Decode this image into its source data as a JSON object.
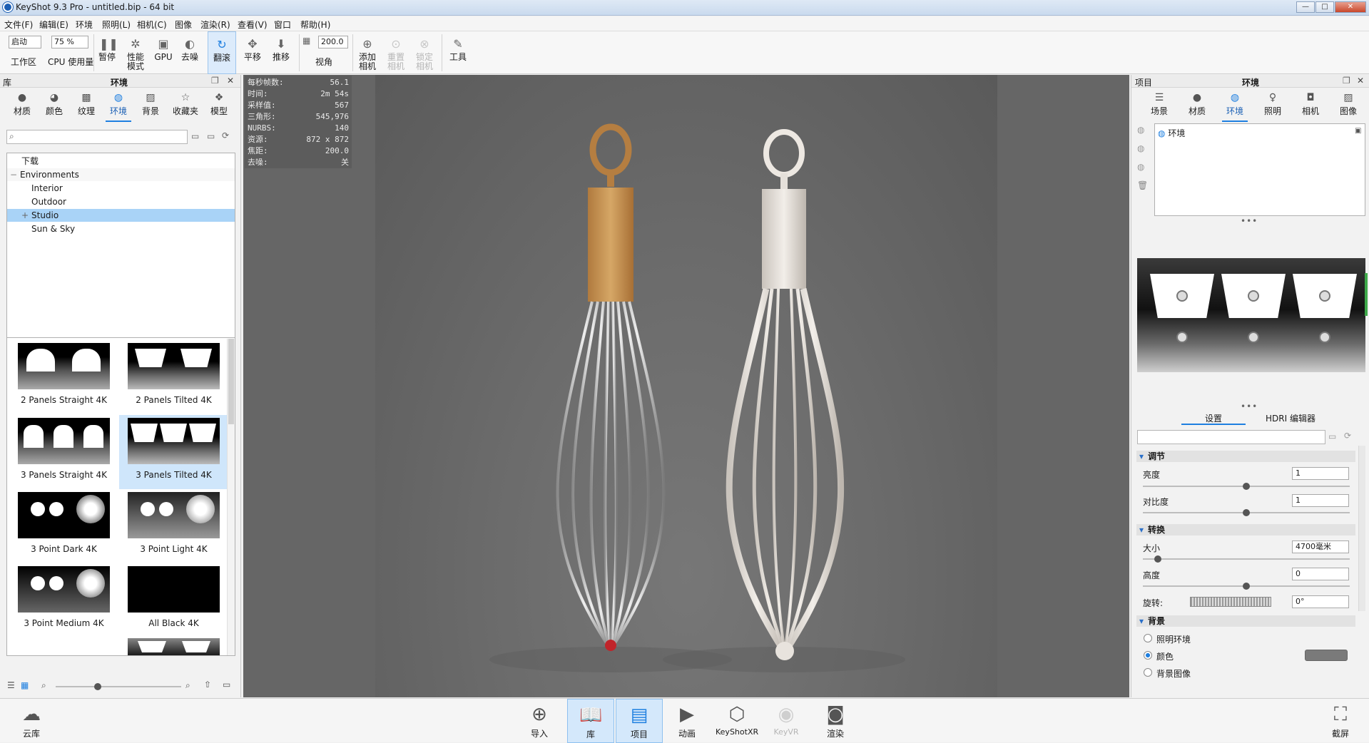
{
  "window": {
    "title": "KeyShot 9.3 Pro  - untitled.bip  - 64 bit",
    "min": "—",
    "max": "□",
    "close": "✕"
  },
  "menu": [
    "文件(F)",
    "编辑(E)",
    "环境",
    "照明(L)",
    "相机(C)",
    "图像",
    "渲染(R)",
    "查看(V)",
    "窗口",
    "帮助(H)"
  ],
  "toolbar": {
    "mode_select": "启动",
    "cpu_percent": "75 %",
    "fov_value": "200.0",
    "workspace": "工作区",
    "cpu_usage": "CPU 使用量",
    "pause": "暂停",
    "perf_mode": "性能模式",
    "gpu": "GPU",
    "denoise": "去噪",
    "tumble": "翻滚",
    "pan": "平移",
    "dolly": "推移",
    "fov": "视角",
    "add_camera": "添加相机",
    "reset_camera": "重置相机",
    "lock_camera": "锁定相机",
    "tools": "工具"
  },
  "library": {
    "title": "环境",
    "header_left": "库",
    "tabs": [
      "材质",
      "颜色",
      "纹理",
      "环境",
      "背景",
      "收藏夹",
      "模型"
    ],
    "tree": {
      "download": "下载",
      "root": "Environments",
      "items": [
        "Interior",
        "Outdoor",
        "Studio",
        "Sun & Sky"
      ]
    },
    "thumbs": [
      "2 Panels Straight 4K",
      "2 Panels Tilted 4K",
      "3 Panels Straight 4K",
      "3 Panels Tilted 4K",
      "3 Point Dark 4K",
      "3 Point Light 4K",
      "3 Point Medium 4K",
      "All Black 4K"
    ]
  },
  "stats": [
    {
      "k": "每秒帧数:",
      "v": "56.1"
    },
    {
      "k": "时间:",
      "v": "2m 54s"
    },
    {
      "k": "采样值:",
      "v": "567"
    },
    {
      "k": "三角形:",
      "v": "545,976"
    },
    {
      "k": "NURBS:",
      "v": "140"
    },
    {
      "k": "资源:",
      "v": "872 x 872"
    },
    {
      "k": "焦距:",
      "v": "200.0"
    },
    {
      "k": "去噪:",
      "v": "关"
    }
  ],
  "project": {
    "header_left": "项目",
    "title": "环境",
    "tabs": [
      "场景",
      "材质",
      "环境",
      "照明",
      "相机",
      "图像"
    ],
    "env_item": "环境",
    "subtabs": [
      "设置",
      "HDRI 编辑器"
    ],
    "adjust": {
      "title": "调节",
      "brightness_label": "亮度",
      "brightness": "1",
      "contrast_label": "对比度",
      "contrast": "1"
    },
    "transform": {
      "title": "转换",
      "size_label": "大小",
      "size": "4700毫米",
      "height_label": "高度",
      "height": "0",
      "rotation_label": "旋转:",
      "rotation": "0°"
    },
    "background": {
      "title": "背景",
      "options": [
        "照明环境",
        "颜色",
        "背景图像"
      ],
      "selected": 1,
      "color": "#7a7a7a"
    }
  },
  "bottombar": {
    "cloud": "云库",
    "import": "导入",
    "library": "库",
    "project": "项目",
    "animation": "动画",
    "keyshotxr": "KeyShotXR",
    "keyvr": "KeyVR",
    "render": "渲染",
    "screenshot": "截屏"
  }
}
